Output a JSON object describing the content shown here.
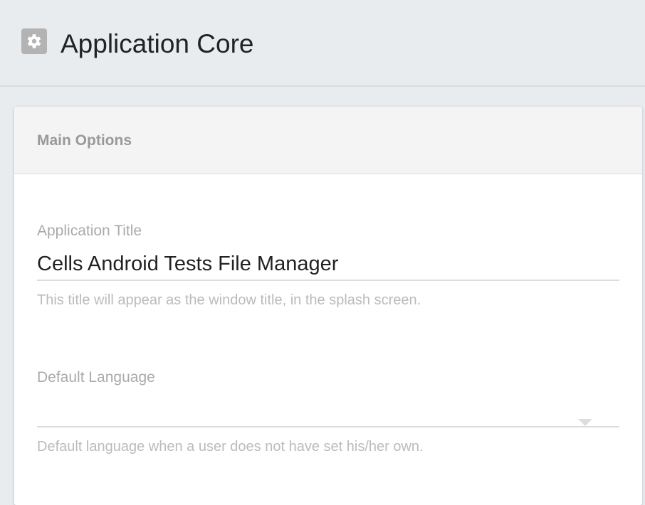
{
  "header": {
    "title": "Application Core",
    "icon": "gear-icon"
  },
  "card": {
    "title": "Main Options"
  },
  "fields": [
    {
      "label": "Application Title",
      "value": "Cells Android Tests File Manager",
      "helper": "This title will appear as the window title, in the splash screen."
    },
    {
      "label": "Default Language",
      "value": "",
      "helper": "Default language when a user does not have set his/her own."
    }
  ]
}
